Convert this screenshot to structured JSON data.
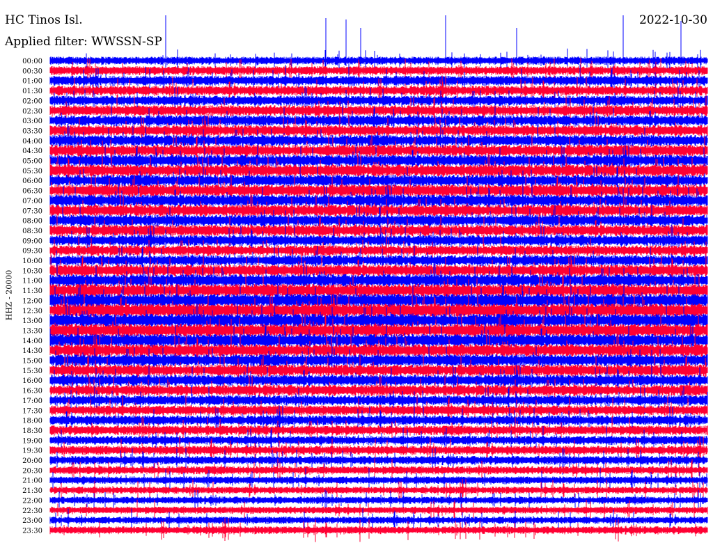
{
  "header": {
    "station": "HC Tinos Isl.",
    "filter": "Applied filter: WWSSN-SP",
    "date": "2022-10-30"
  },
  "chart_data": {
    "type": "line",
    "title": "HC Tinos Isl.",
    "subtitle": "Applied filter: WWSSN-SP",
    "date": "2022-10-30",
    "ylabel": "HHZ - 20000",
    "trace_colors": [
      "#0000ff",
      "#ff0033"
    ],
    "row_labels": [
      "00:00",
      "00:30",
      "01:00",
      "01:30",
      "02:00",
      "02:30",
      "03:00",
      "03:30",
      "04:00",
      "04:30",
      "05:00",
      "05:30",
      "06:00",
      "06:30",
      "07:00",
      "07:30",
      "08:00",
      "08:30",
      "09:00",
      "09:30",
      "10:00",
      "10:30",
      "11:00",
      "11:30",
      "12:00",
      "12:30",
      "13:00",
      "13:30",
      "14:00",
      "14:30",
      "15:00",
      "15:30",
      "16:00",
      "16:30",
      "17:00",
      "17:30",
      "18:00",
      "18:30",
      "19:00",
      "19:30",
      "20:00",
      "20:30",
      "21:00",
      "21:30",
      "22:00",
      "22:30",
      "23:00",
      "23:30"
    ],
    "noise_level": [
      0.9,
      1.0,
      1.1,
      1.1,
      1.1,
      1.2,
      1.2,
      1.2,
      1.25,
      1.3,
      1.3,
      1.35,
      1.3,
      1.35,
      1.35,
      1.3,
      1.3,
      1.25,
      1.2,
      1.15,
      1.2,
      1.3,
      1.4,
      1.45,
      1.5,
      1.55,
      1.5,
      1.5,
      1.45,
      1.4,
      1.35,
      1.3,
      1.25,
      1.2,
      1.15,
      1.1,
      1.1,
      1.05,
      1.0,
      1.0,
      0.95,
      0.9,
      0.85,
      0.8,
      0.8,
      0.8,
      0.8,
      0.85
    ]
  }
}
